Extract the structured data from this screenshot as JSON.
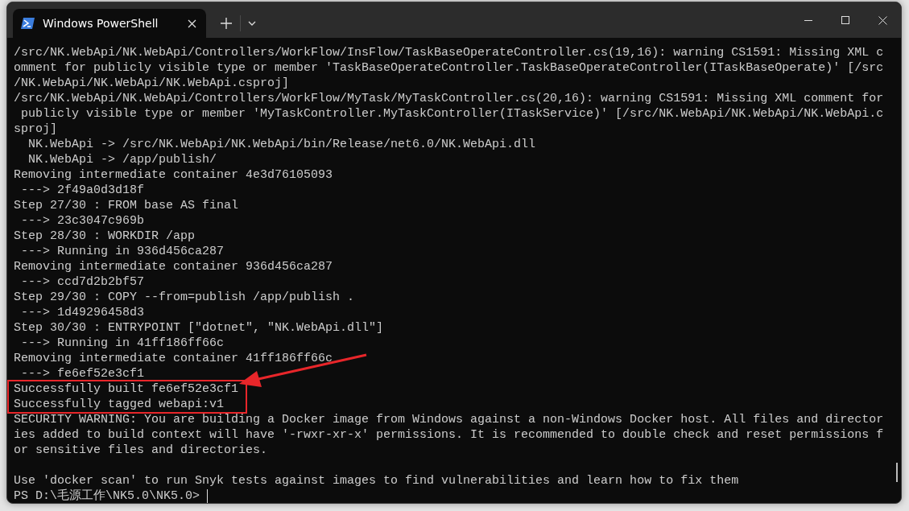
{
  "tab": {
    "title": "Windows PowerShell",
    "selected": true
  },
  "lines": [
    {
      "kind": "output",
      "text": "/src/NK.WebApi/NK.WebApi/Controllers/WorkFlow/InsFlow/TaskBaseOperateController.cs(19,16): warning CS1591: Missing XML c",
      "highlighted": false
    },
    {
      "kind": "output",
      "text": "omment for publicly visible type or member 'TaskBaseOperateController.TaskBaseOperateController(ITaskBaseOperate)' [/src",
      "highlighted": false
    },
    {
      "kind": "output",
      "text": "/NK.WebApi/NK.WebApi/NK.WebApi.csproj]",
      "highlighted": false
    },
    {
      "kind": "output",
      "text": "/src/NK.WebApi/NK.WebApi/Controllers/WorkFlow/MyTask/MyTaskController.cs(20,16): warning CS1591: Missing XML comment for",
      "highlighted": false
    },
    {
      "kind": "output",
      "text": " publicly visible type or member 'MyTaskController.MyTaskController(ITaskService)' [/src/NK.WebApi/NK.WebApi/NK.WebApi.c",
      "highlighted": false
    },
    {
      "kind": "output",
      "text": "sproj]",
      "highlighted": false
    },
    {
      "kind": "output",
      "text": "  NK.WebApi -> /src/NK.WebApi/NK.WebApi/bin/Release/net6.0/NK.WebApi.dll",
      "highlighted": false
    },
    {
      "kind": "output",
      "text": "  NK.WebApi -> /app/publish/",
      "highlighted": false
    },
    {
      "kind": "output",
      "text": "Removing intermediate container 4e3d76105093",
      "highlighted": false
    },
    {
      "kind": "output",
      "text": " ---> 2f49a0d3d18f",
      "highlighted": false
    },
    {
      "kind": "output",
      "text": "Step 27/30 : FROM base AS final",
      "highlighted": false
    },
    {
      "kind": "output",
      "text": " ---> 23c3047c969b",
      "highlighted": false
    },
    {
      "kind": "output",
      "text": "Step 28/30 : WORKDIR /app",
      "highlighted": false
    },
    {
      "kind": "output",
      "text": " ---> Running in 936d456ca287",
      "highlighted": false
    },
    {
      "kind": "output",
      "text": "Removing intermediate container 936d456ca287",
      "highlighted": false
    },
    {
      "kind": "output",
      "text": " ---> ccd7d2b2bf57",
      "highlighted": false
    },
    {
      "kind": "output",
      "text": "Step 29/30 : COPY --from=publish /app/publish .",
      "highlighted": false
    },
    {
      "kind": "output",
      "text": " ---> 1d49296458d3",
      "highlighted": false
    },
    {
      "kind": "output",
      "text": "Step 30/30 : ENTRYPOINT [\"dotnet\", \"NK.WebApi.dll\"]",
      "highlighted": false
    },
    {
      "kind": "output",
      "text": " ---> Running in 41ff186ff66c",
      "highlighted": false
    },
    {
      "kind": "output",
      "text": "Removing intermediate container 41ff186ff66c",
      "highlighted": false
    },
    {
      "kind": "output",
      "text": " ---> fe6ef52e3cf1",
      "highlighted": false
    },
    {
      "kind": "output",
      "text": "Successfully built fe6ef52e3cf1",
      "highlighted": true
    },
    {
      "kind": "output",
      "text": "Successfully tagged webapi:v1",
      "highlighted": true
    },
    {
      "kind": "output",
      "text": "SECURITY WARNING: You are building a Docker image from Windows against a non-Windows Docker host. All files and director",
      "highlighted": false
    },
    {
      "kind": "output",
      "text": "ies added to build context will have '-rwxr-xr-x' permissions. It is recommended to double check and reset permissions f",
      "highlighted": false
    },
    {
      "kind": "output",
      "text": "or sensitive files and directories.",
      "highlighted": false
    },
    {
      "kind": "blank"
    },
    {
      "kind": "output",
      "text": "Use 'docker scan' to run Snyk tests against images to find vulnerabilities and learn how to fix them",
      "highlighted": false
    }
  ],
  "prompt": "PS D:\\毛源工作\\NK5.0\\NK5.0>"
}
